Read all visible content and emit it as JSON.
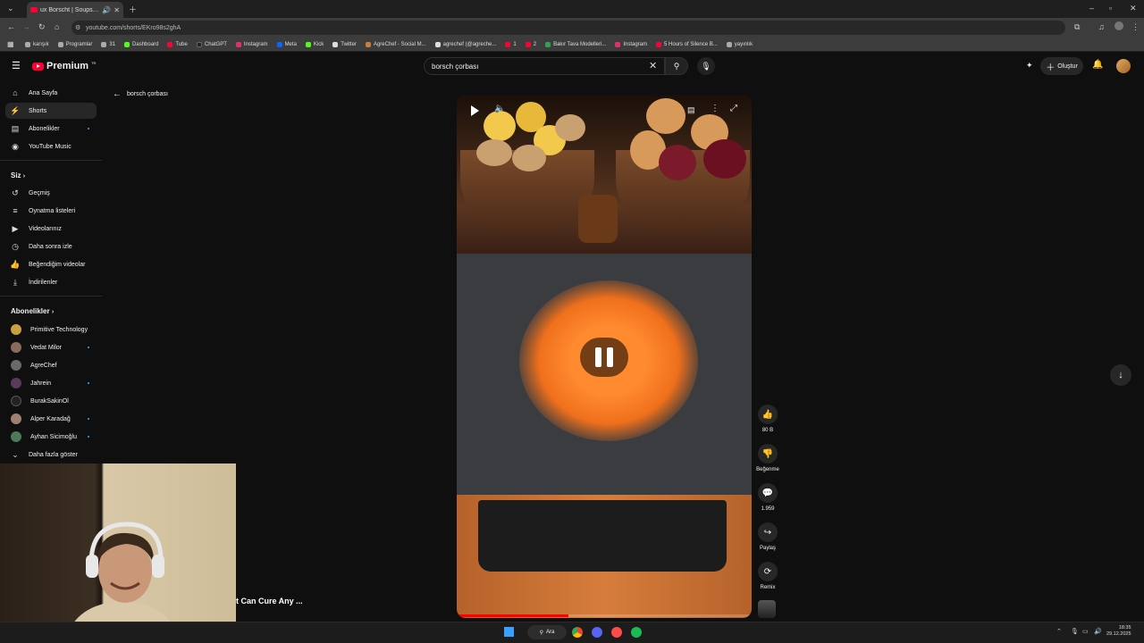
{
  "browser": {
    "tab_title": "ux Borscht | Soups So Good",
    "url": "youtube.com/shorts/EKro98s2ghA",
    "bookmarks": [
      {
        "label": "karışık",
        "color": "#aaaaaa"
      },
      {
        "label": "Programlar",
        "color": "#aaaaaa"
      },
      {
        "label": "31",
        "color": "#aaaaaa"
      },
      {
        "label": "Dashboard",
        "color": "#53fc18"
      },
      {
        "label": "Tube",
        "color": "#ff0033"
      },
      {
        "label": "ChatGPT",
        "color": "#222222"
      },
      {
        "label": "Instagram",
        "color": "#e1306c"
      },
      {
        "label": "Meta",
        "color": "#0866ff"
      },
      {
        "label": "Kick",
        "color": "#53fc18"
      },
      {
        "label": "Twitter",
        "color": "#dddddd"
      },
      {
        "label": "AgreChef - Social M...",
        "color": "#c97b3a"
      },
      {
        "label": "agrechef (@agreche...",
        "color": "#dddddd"
      },
      {
        "label": "1",
        "color": "#ff0033"
      },
      {
        "label": "2",
        "color": "#ff0033"
      },
      {
        "label": "Bakır Tava Modelleri...",
        "color": "#2ea44f"
      },
      {
        "label": "Instagram",
        "color": "#e1306c"
      },
      {
        "label": "5 Hours of Silence B...",
        "color": "#ff0033"
      },
      {
        "label": "yayınlık",
        "color": "#aaaaaa"
      }
    ]
  },
  "header": {
    "logo_text": "Premium",
    "logo_sup": "TR",
    "search_value": "borsch çorbası",
    "create_label": "Oluştur"
  },
  "sidebar": {
    "main": [
      {
        "label": "Ana Sayfa",
        "icon": "home-icon"
      },
      {
        "label": "Shorts",
        "icon": "shorts-icon",
        "active": true
      },
      {
        "label": "Abonelikler",
        "icon": "subscriptions-icon",
        "dot": true
      },
      {
        "label": "YouTube Music",
        "icon": "music-icon"
      }
    ],
    "you_heading": "Siz",
    "you": [
      {
        "label": "Geçmiş",
        "icon": "history-icon"
      },
      {
        "label": "Oynatma listeleri",
        "icon": "playlists-icon"
      },
      {
        "label": "Videolarınız",
        "icon": "your-videos-icon"
      },
      {
        "label": "Daha sonra izle",
        "icon": "watch-later-icon"
      },
      {
        "label": "Beğendiğim videolar",
        "icon": "liked-icon"
      },
      {
        "label": "İndirilenler",
        "icon": "downloads-icon"
      }
    ],
    "subs_heading": "Abonelikler",
    "subs": [
      {
        "label": "Primitive Technology",
        "color": "#c8a040",
        "dot": false
      },
      {
        "label": "Vedat Milor",
        "color": "#8a6a5a",
        "dot": true
      },
      {
        "label": "AgreChef",
        "color": "#6a6a6a",
        "dot": false
      },
      {
        "label": "Jahrein",
        "color": "#5a3a5a",
        "dot": true
      },
      {
        "label": "BurakSakinOl",
        "color": "#222222",
        "dot": false
      },
      {
        "label": "Alper Karadağ",
        "color": "#a08070",
        "dot": true
      },
      {
        "label": "Ayhan Sicimoğlu",
        "color": "#4a7a5a",
        "dot": true
      }
    ],
    "show_more": "Daha fazla göster"
  },
  "back_label": "borsch çorbası",
  "player": {
    "progress": 0.38
  },
  "actions": {
    "like_count": "80 B",
    "dislike_label": "Beğenme",
    "comment_count": "1.959",
    "share_label": "Paylaş",
    "remix_label": "Remix"
  },
  "overlay_caption": "t Can Cure Any ...",
  "taskbar": {
    "search_label": "Ara",
    "time": "18:35",
    "date": "29.12.2025"
  }
}
